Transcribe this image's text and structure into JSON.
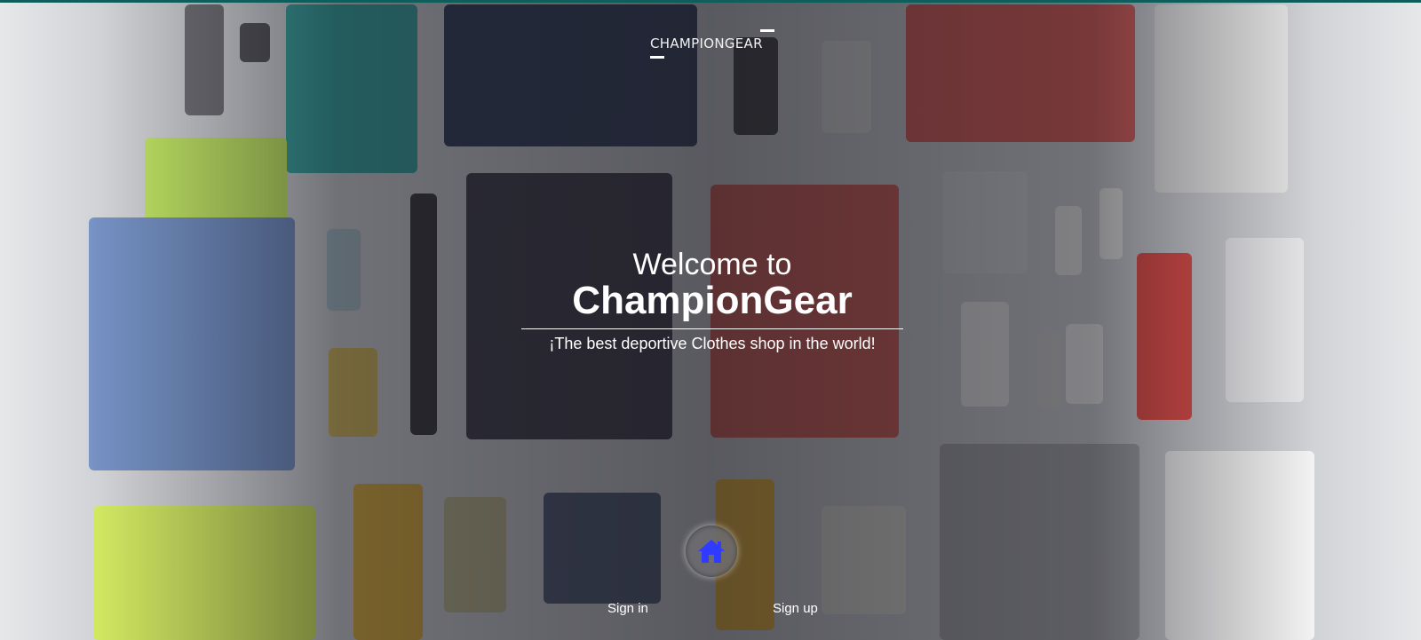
{
  "brand": {
    "name": "CHAMPIONGEAR"
  },
  "hero": {
    "welcome": "Welcome to",
    "title": "ChampionGear",
    "tagline": "¡The best deportive Clothes shop in the world!"
  },
  "nav": {
    "home_icon": "home-icon",
    "sign_in": "Sign in",
    "sign_up": "Sign up"
  },
  "colors": {
    "top_strip": "#0e5f5c",
    "home_icon": "#2f3bff",
    "text": "#ffffff"
  }
}
